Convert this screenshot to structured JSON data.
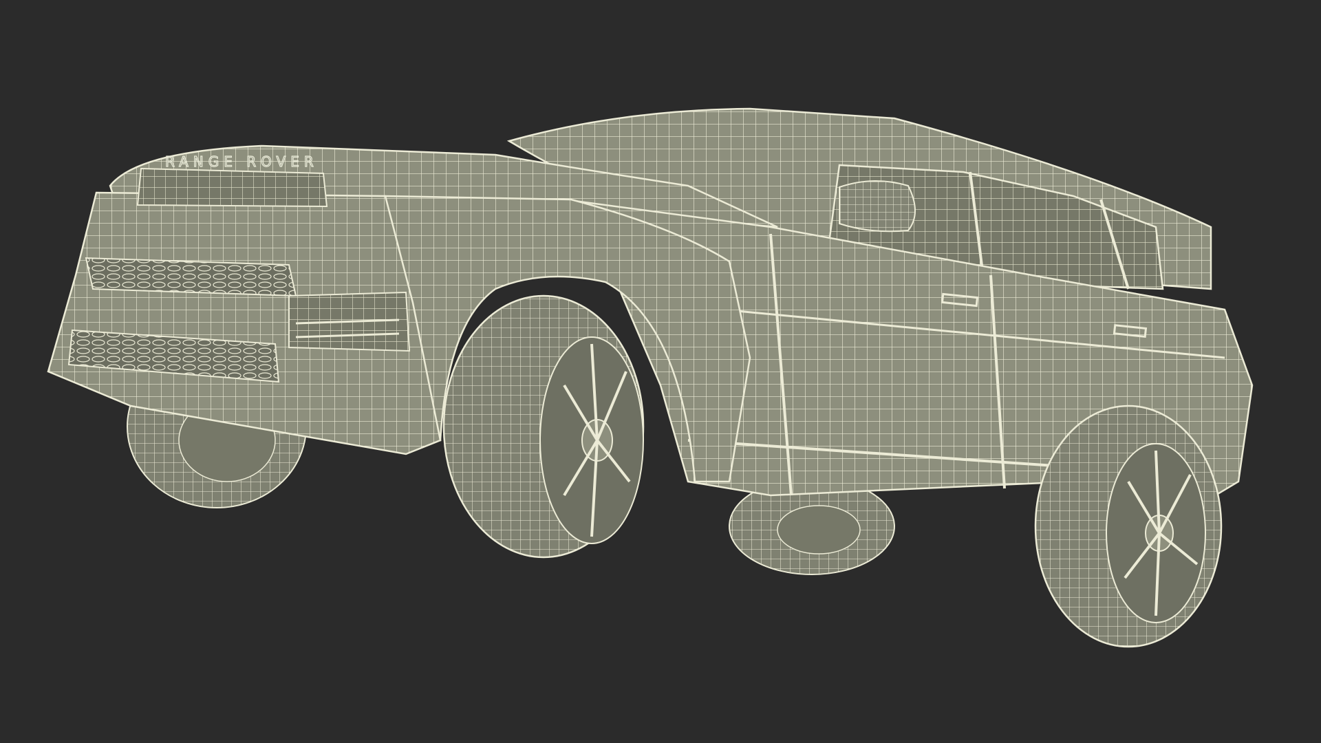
{
  "scene": {
    "background_color": "#2b2b2b",
    "surface_color": "#8d8f7d",
    "surface_shadow_color": "#6f7162",
    "wire_color": "#ecebd6",
    "subject": "car-wireframe",
    "badge_text": "RANGE ROVER"
  }
}
